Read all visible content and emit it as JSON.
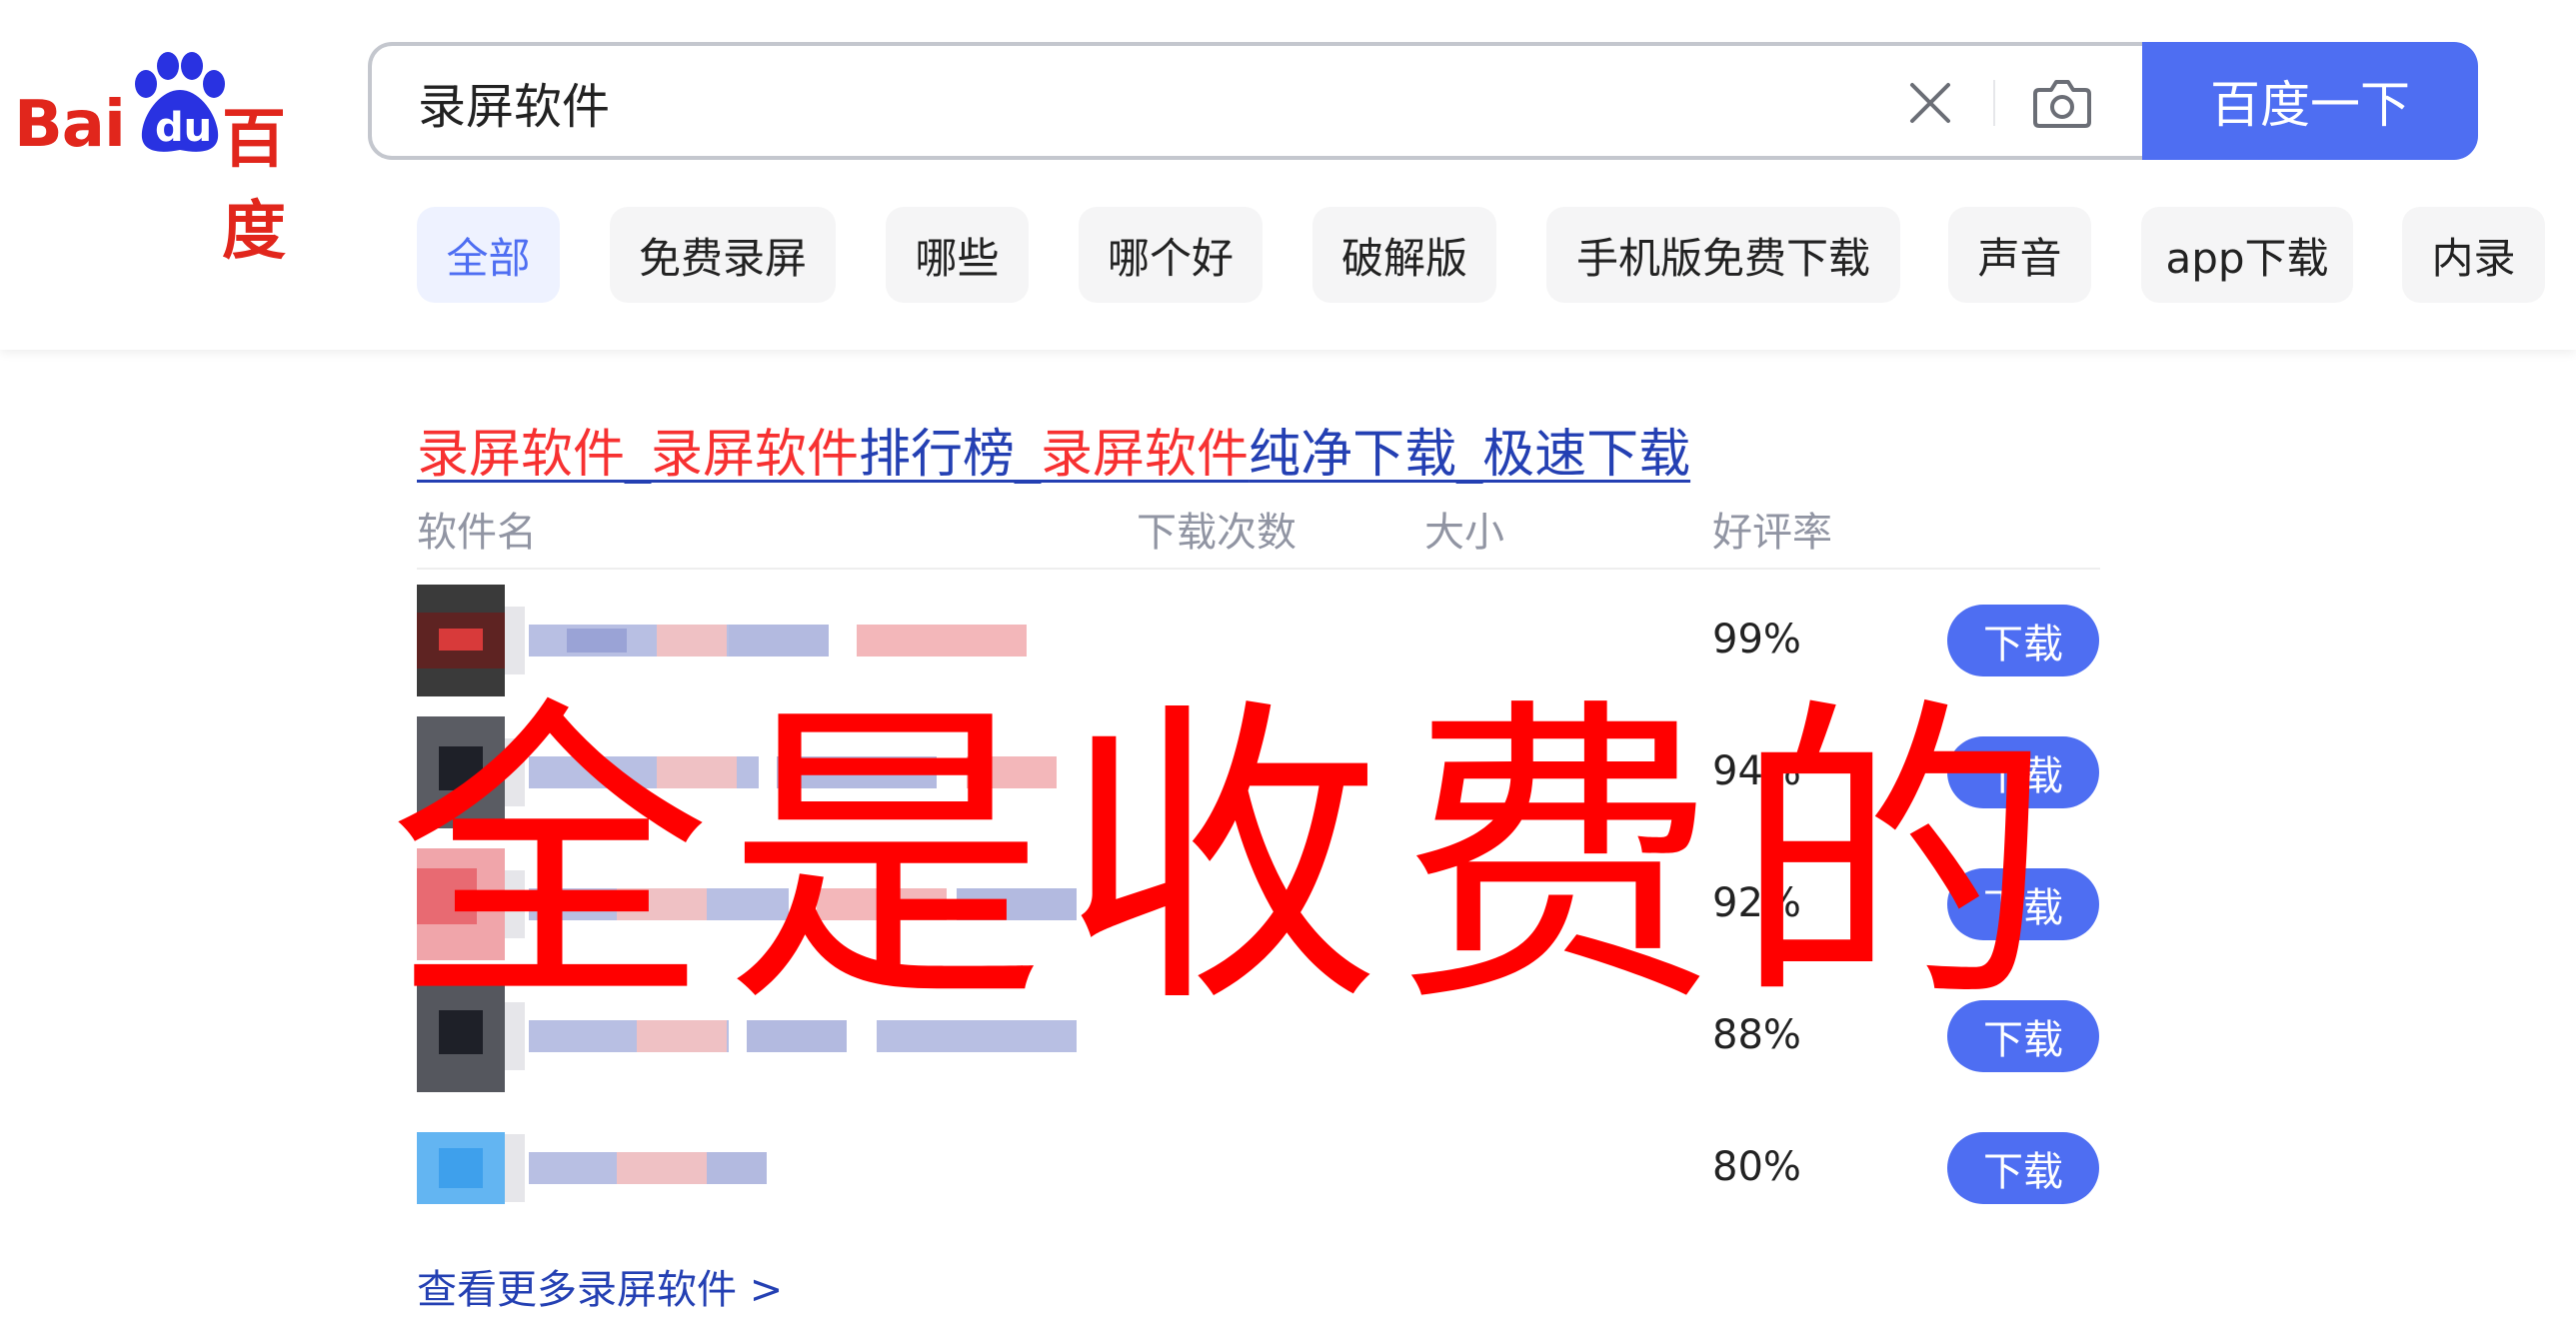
{
  "logo": {
    "latin": "Bai",
    "badge": "du",
    "cn": "百度",
    "brand_color": "#e1261c"
  },
  "search": {
    "query": "录屏软件",
    "button_label": "百度一下",
    "accent": "#4e6ef2"
  },
  "tabs": [
    {
      "label": "全部",
      "active": true
    },
    {
      "label": "免费录屏"
    },
    {
      "label": "哪些"
    },
    {
      "label": "哪个好"
    },
    {
      "label": "破解版"
    },
    {
      "label": "手机版免费下载"
    },
    {
      "label": "声音"
    },
    {
      "label": "app下载"
    },
    {
      "label": "内录"
    }
  ],
  "result": {
    "title_parts": [
      "录屏软件",
      "_",
      "录屏软件",
      "排行榜_",
      "录屏软件",
      "纯净下载_极速下载"
    ],
    "columns": {
      "name": "软件名",
      "downloads": "下载次数",
      "size": "大小",
      "rating": "好评率"
    },
    "rows": [
      {
        "rating": "99%",
        "action": "下载"
      },
      {
        "rating": "94%",
        "action": "下载"
      },
      {
        "rating": "92%",
        "action": "下载"
      },
      {
        "rating": "88%",
        "action": "下载"
      },
      {
        "rating": "80%",
        "action": "下载"
      }
    ],
    "more_link": "查看更多录屏软件 >"
  },
  "overlay_text": "全是收费的",
  "colors": {
    "link": "#2440b3",
    "highlight": "#f73131",
    "overlay": "#ff0000"
  }
}
